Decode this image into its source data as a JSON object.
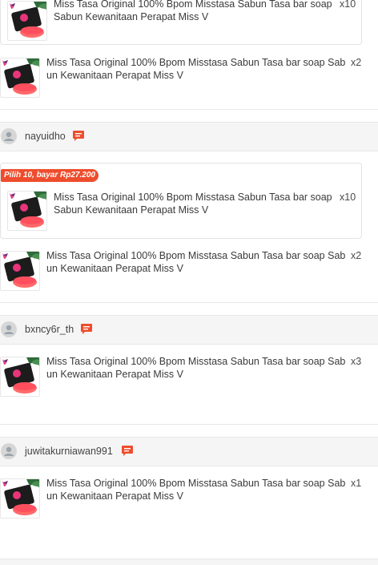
{
  "product": {
    "title": "Miss Tasa Original 100% Bpom Misstasa Sabun Tasa bar soap Sabun Kewanitaan Perapat Miss V"
  },
  "groups": [
    {
      "bundle_promo": "",
      "bundle_qty": "x10",
      "single_qty": "x2"
    },
    {
      "username": "nayuidho",
      "bundle_promo": "Pilih 10, bayar Rp27.200",
      "bundle_qty": "x10",
      "single_qty": "x2"
    },
    {
      "username": "bxncy6r_th",
      "single_qty": "x3"
    },
    {
      "username": "juwitakurniawan991",
      "single_qty": "x1"
    }
  ],
  "icons": {
    "user_avatar": "user-avatar-icon",
    "chat": "chat-icon"
  },
  "colors": {
    "accent": "#ee4d2d",
    "product_pink": "#e8357a",
    "soap_red": "#ff5a5a",
    "leaf_green": "#2e6b3a"
  }
}
